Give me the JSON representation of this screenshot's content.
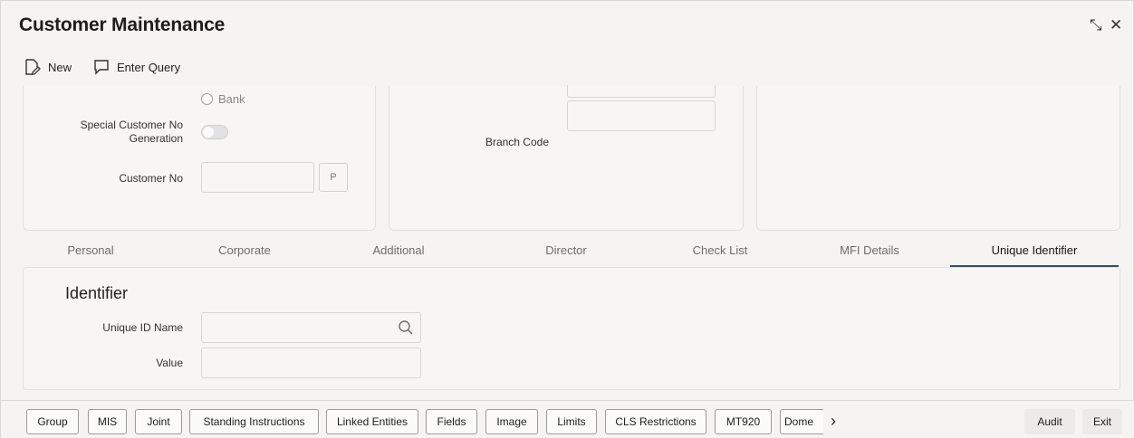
{
  "window": {
    "title": "Customer Maintenance",
    "restore_glyph": "⤡",
    "close_glyph": "✕"
  },
  "toolbar": {
    "new_label": "New",
    "enter_query_label": "Enter Query"
  },
  "form": {
    "bank_radio_label": "Bank",
    "special_customer_label": "Special Customer No Generation",
    "customer_no_label": "Customer No",
    "customer_no_value": "",
    "p_button_label": "P",
    "branch_code_label": "Branch Code",
    "branch_code_value": ""
  },
  "tabs": [
    {
      "label": "Personal",
      "active": false
    },
    {
      "label": "Corporate",
      "active": false
    },
    {
      "label": "Additional",
      "active": false
    },
    {
      "label": "Director",
      "active": false
    },
    {
      "label": "Check List",
      "active": false
    },
    {
      "label": "MFI Details",
      "active": false
    },
    {
      "label": "Unique Identifier",
      "active": true
    }
  ],
  "identifier": {
    "section_title": "Identifier",
    "unique_id_name_label": "Unique ID Name",
    "unique_id_name_value": "",
    "value_label": "Value",
    "value_value": ""
  },
  "footer": {
    "buttons": [
      "Group",
      "MIS",
      "Joint",
      "Standing Instructions",
      "Linked Entities",
      "Fields",
      "Image",
      "Limits",
      "CLS Restrictions",
      "MT920",
      "Dome"
    ],
    "next_glyph": "›",
    "audit_label": "Audit",
    "exit_label": "Exit"
  }
}
